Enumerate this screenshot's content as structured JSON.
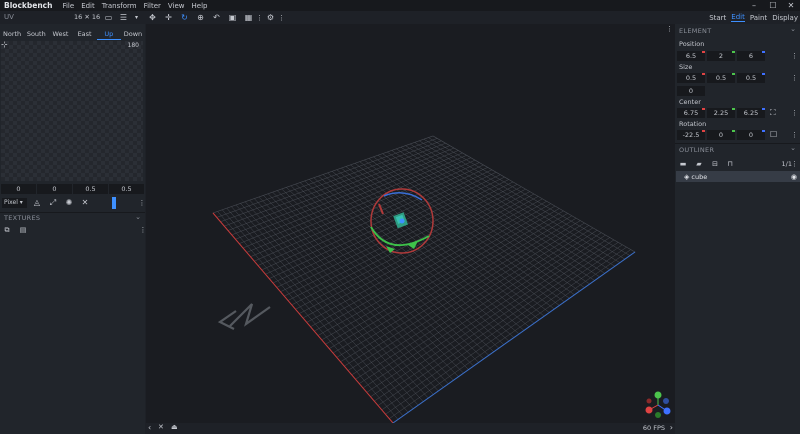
{
  "app": {
    "name": "Blockbench",
    "menu": [
      "File",
      "Edit",
      "Transform",
      "Filter",
      "View",
      "Help"
    ]
  },
  "toolbar": {
    "uv_label": "UV",
    "resolution": "16 ✕ 16",
    "modes": [
      {
        "label": "Start",
        "active": false
      },
      {
        "label": "Edit",
        "active": true
      },
      {
        "label": "Paint",
        "active": false
      },
      {
        "label": "Display",
        "active": false
      }
    ]
  },
  "uv": {
    "faces": [
      {
        "label": "North",
        "active": false
      },
      {
        "label": "South",
        "active": false
      },
      {
        "label": "West",
        "active": false
      },
      {
        "label": "East",
        "active": false
      },
      {
        "label": "Up",
        "active": true
      },
      {
        "label": "Down",
        "active": false
      }
    ],
    "canvas_size": "180",
    "values": [
      "0",
      "0",
      "0.5",
      "0.5"
    ],
    "pixel_mode": "Pixel"
  },
  "textures": {
    "title": "TEXTURES"
  },
  "element": {
    "title": "ELEMENT",
    "position_label": "Position",
    "position": [
      "6.5",
      "2",
      "6"
    ],
    "size_label": "Size",
    "size": [
      "0.5",
      "0.5",
      "0.5",
      "0"
    ],
    "center_label": "Center",
    "center": [
      "6.75",
      "2.25",
      "6.25"
    ],
    "rotation_label": "Rotation",
    "rotation": [
      "-22.5",
      "0",
      "0"
    ]
  },
  "outliner": {
    "title": "OUTLINER",
    "count": "1/1",
    "items": [
      {
        "name": "cube"
      }
    ]
  },
  "status": {
    "fps": "60 FPS"
  },
  "colors": {
    "accent": "#3e90ff",
    "axis_x": "#e04343",
    "axis_y": "#4cc44c",
    "axis_z": "#3e70ff"
  }
}
